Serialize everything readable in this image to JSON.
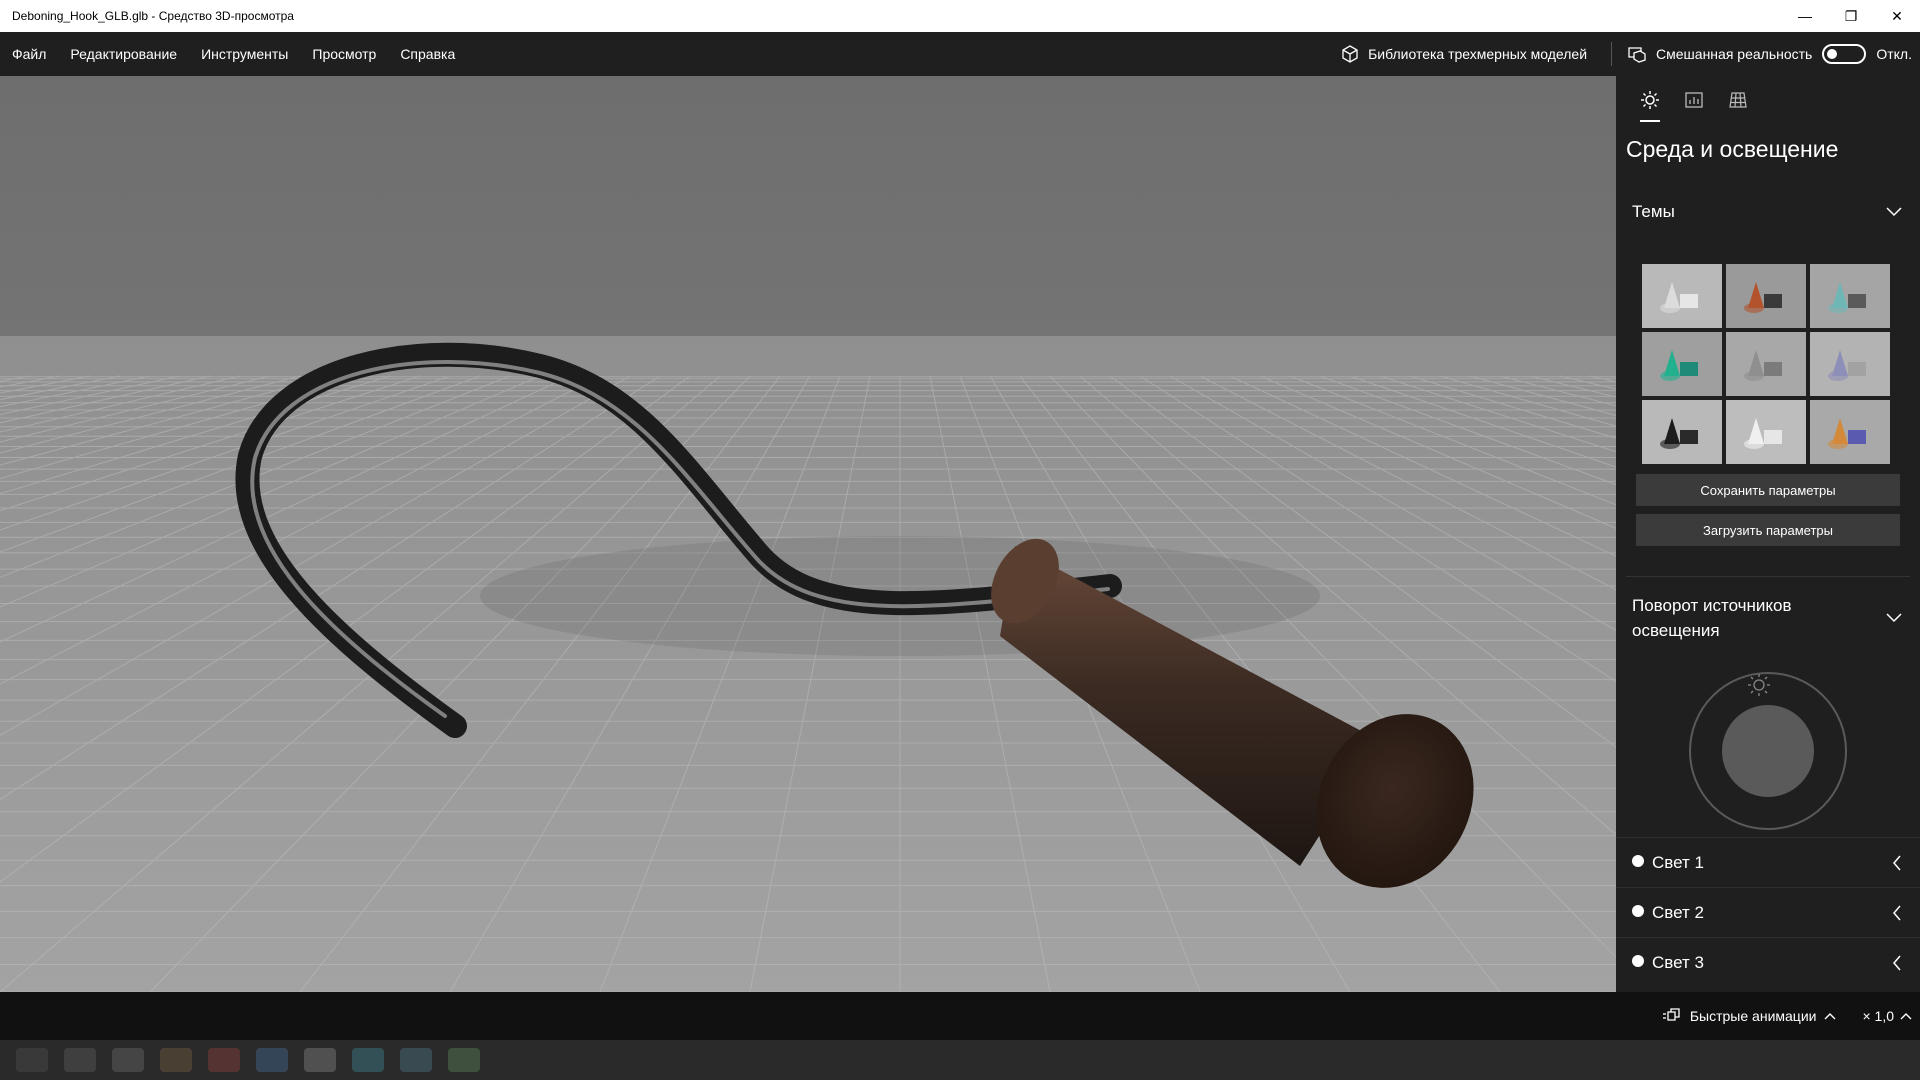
{
  "window": {
    "title": "Deboning_Hook_GLB.glb - Средство 3D-просмотра",
    "minimize": "—",
    "maximize": "❐",
    "close": "✕"
  },
  "menu": {
    "items": [
      "Файл",
      "Редактирование",
      "Инструменты",
      "Просмотр",
      "Справка"
    ],
    "library_label": "Библиотека трехмерных моделей",
    "mixed_reality_label": "Смешанная реальность",
    "mixed_reality_state": "Откл."
  },
  "panel": {
    "title": "Среда и освещение",
    "themes_label": "Темы",
    "themes": [
      {
        "bg": "#b9b9b9",
        "a": "#dcdcdc",
        "b": "#e6e6e6"
      },
      {
        "bg": "#9a9a9a",
        "a": "#b2532e",
        "b": "#3a3a3a"
      },
      {
        "bg": "#a5a5a5",
        "a": "#6fb6b6",
        "b": "#5a5a5a"
      },
      {
        "bg": "#9f9f9f",
        "a": "#23b08f",
        "b": "#1f8a78"
      },
      {
        "bg": "#a8a8a8",
        "a": "#8f8f8f",
        "b": "#7b7b7b"
      },
      {
        "bg": "#b3b3b3",
        "a": "#8d8fb8",
        "b": "#a2a2a2"
      },
      {
        "bg": "#b9b9b9",
        "a": "#1d1d1d",
        "b": "#2a2a2a"
      },
      {
        "bg": "#bdbdbd",
        "a": "#f0f0f0",
        "b": "#e6e6e6"
      },
      {
        "bg": "#a9a9a9",
        "a": "#d48a3b",
        "b": "#5a5ab0"
      }
    ],
    "save_button": "Сохранить параметры",
    "load_button": "Загрузить параметры",
    "rotation_label": "Поворот источников освещения",
    "lights": [
      "Свет 1",
      "Свет 2",
      "Свет 3"
    ]
  },
  "bottom": {
    "animations_label": "Быстрые анимации",
    "speed_label": "× 1,0"
  },
  "colors": {
    "accent": "#ffffff",
    "viewport_bg": "#777777",
    "handle": "#3b2a22",
    "hook": "#2b2b2b"
  }
}
